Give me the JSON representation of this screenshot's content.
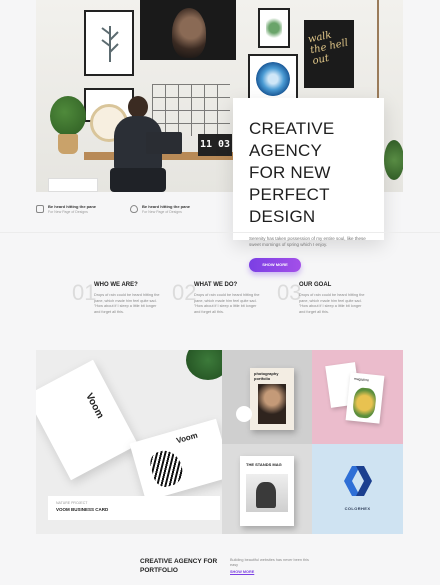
{
  "hero": {
    "clock_text": "11 03",
    "poster_text": "walk the hell out"
  },
  "hero_card": {
    "title_line1": "CREATIVE AGENCY",
    "title_line2": "FOR NEW PERFECT",
    "title_line3": "DESIGN",
    "text": "Serenity has taken possession of my entire soul, like these sweet mornings of spring which I enjoy.",
    "button_label": "SHOW MORE"
  },
  "features": [
    {
      "title": "Be heard hitting the pane",
      "subtitle": "For New Page of Designs"
    },
    {
      "title": "Be heard hitting the pane",
      "subtitle": "For New Page of Designs"
    }
  ],
  "about": [
    {
      "number": "01",
      "heading": "WHO WE ARE?",
      "text": "Drops of rain could be heard hitting the pane, which made him feel quite sad. \"How about if I sleep a little bit longer and forget all this."
    },
    {
      "number": "02",
      "heading": "WHAT WE DO?",
      "text": "Drops of rain could be heard hitting the pane, which made him feel quite sad. \"How about if I sleep a little bit longer and forget all this."
    },
    {
      "number": "03",
      "heading": "OUR GOAL",
      "text": "Drops of rain could be heard hitting the pane, which made him feel quite sad. \"How about if I sleep a little bit longer and forget all this."
    }
  ],
  "portfolio": {
    "card_brand": "Voom",
    "caption_small": "NATURE PROJECT",
    "caption_title": "VOOM BUSINESS CARD",
    "book_title": "photography portfolio",
    "mag_title": "THE STANDS MAG",
    "pink_mag_text": "magazine",
    "logo_caption": "COLORHEX"
  },
  "bottom": {
    "title_line1": "CREATIVE AGENCY FOR",
    "title_line2": "PORTFOLIO",
    "text": "Building beautiful websites has never been this easy",
    "link": "SHOW MORE"
  }
}
